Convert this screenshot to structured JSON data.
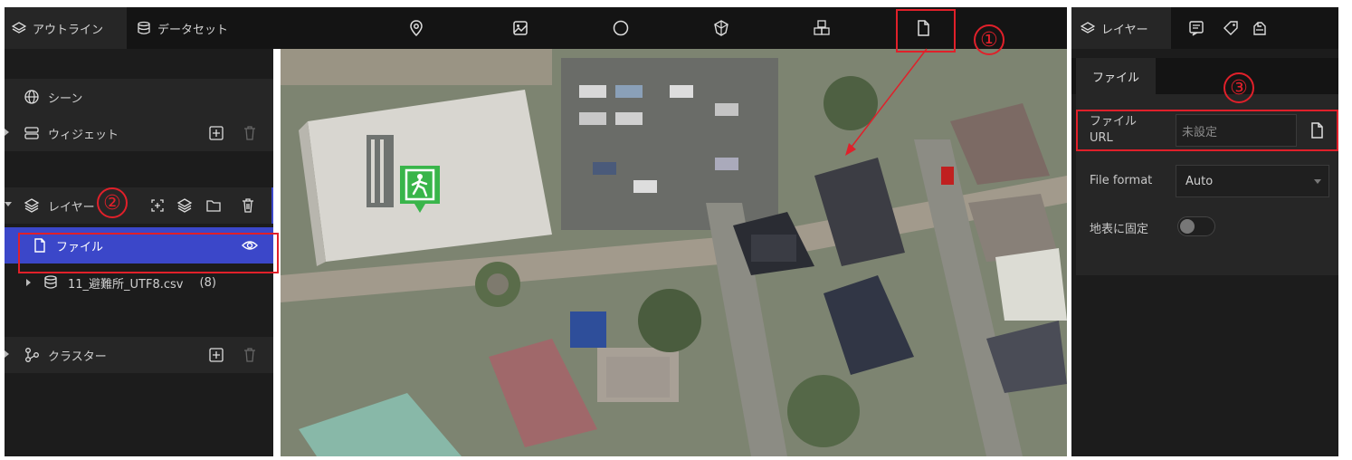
{
  "top_bar": {
    "tabs": [
      {
        "label": "アウトライン",
        "icon": "layers-icon"
      },
      {
        "label": "データセット",
        "icon": "database-icon"
      }
    ],
    "tools": [
      "pin-icon",
      "image-icon",
      "circle-icon",
      "box-icon",
      "cubes-icon",
      "file-icon"
    ]
  },
  "outline": {
    "scene": "シーン",
    "widget": "ウィジェット",
    "layers": "レイヤー",
    "file_layer": "ファイル",
    "dataset_name": "11_避難所_UTF8.csv",
    "dataset_count": "(8)",
    "cluster": "クラスター"
  },
  "right_panel": {
    "tabs": [
      {
        "label": "レイヤー",
        "icon": "layers-icon"
      }
    ],
    "section_tab": "ファイル",
    "fields": {
      "file_url_label_line1": "ファイル",
      "file_url_label_line2": "URL",
      "file_url_placeholder": "未設定",
      "file_format_label": "File format",
      "file_format_value": "Auto",
      "clamp_label": "地表に固定"
    }
  },
  "annotations": {
    "one": "①",
    "two": "②",
    "three": "③",
    "color": "#e0202a"
  },
  "colors": {
    "selected_row": "#3b47c9",
    "panel": "#1c1c1c",
    "marker_green": "#39b54a"
  }
}
